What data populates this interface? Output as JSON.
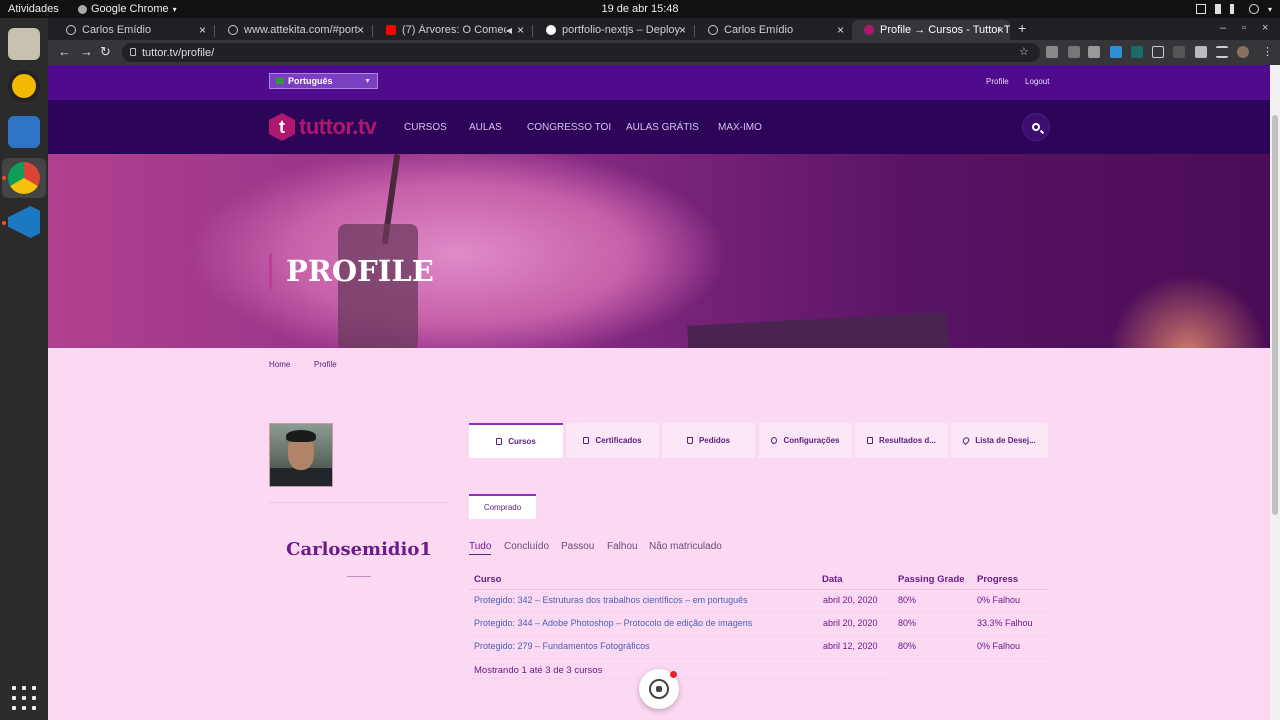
{
  "os": {
    "activities": "Atividades",
    "app_menu": "Google Chrome",
    "clock": "19 de abr  15:48"
  },
  "browser": {
    "tabs": [
      {
        "label": "Carlos Emídio",
        "fav_color": "#cccccc",
        "active": false
      },
      {
        "label": "www.attekita.com/#port",
        "fav_color": "#cccccc",
        "active": false
      },
      {
        "label": "(7) Árvores: O Começo",
        "fav_color": "#ff0000",
        "active": false
      },
      {
        "label": "portfolio-nextjs – Deploy",
        "fav_color": "#ffffff",
        "active": false
      },
      {
        "label": "Carlos Emídio",
        "fav_color": "#cccccc",
        "active": false
      },
      {
        "label": "Profile → Cursos - Tuttor T",
        "fav_color": "#b0176e",
        "active": true
      }
    ],
    "url": "tuttor.tv/profile/"
  },
  "site": {
    "language": "Português",
    "top_links": {
      "profile": "Profile",
      "logout": "Logout"
    },
    "logo_mark": "t",
    "logo_text": "tuttor.tv",
    "nav": [
      "CURSOS",
      "AULAS",
      "CONGRESSO TOI",
      "AULAS GRÁTIS",
      "MAX-IMO"
    ],
    "hero_title": "PROFILE",
    "breadcrumb": [
      "Home",
      "Profile"
    ]
  },
  "profile": {
    "username": "Carlosemidio1",
    "tabs": [
      "Cursos",
      "Certificados",
      "Pedidos",
      "Configurações",
      "Resultados d...",
      "Lista de Desej..."
    ],
    "subtab": "Comprado",
    "filters": [
      "Tudo",
      "Concluído",
      "Passou",
      "Falhou",
      "Não matriculado"
    ],
    "table": {
      "headers": [
        "Curso",
        "Data",
        "Passing Grade",
        "Progress"
      ],
      "rows": [
        [
          "Protegido: 342 – Estruturas dos trabalhos científicos – em português",
          "abril 20, 2020",
          "80%",
          "0% Falhou"
        ],
        [
          "Protegido: 344 – Adobe Photoshop – Protocolo de edição de imagens",
          "abril 20, 2020",
          "80%",
          "33.3% Falhou"
        ],
        [
          "Protegido: 279 – Fundamentos Fotográficos",
          "abril 12, 2020",
          "80%",
          "0% Falhou"
        ]
      ]
    },
    "showing": "Mostrando 1 até 3 de 3 cursos"
  },
  "colors": {
    "top_strip": "#4f0b8c",
    "nav_bg": "#2c0558",
    "brand": "#b0176e",
    "page_bg": "#fcd9f3",
    "accent": "#6d1a8a"
  }
}
